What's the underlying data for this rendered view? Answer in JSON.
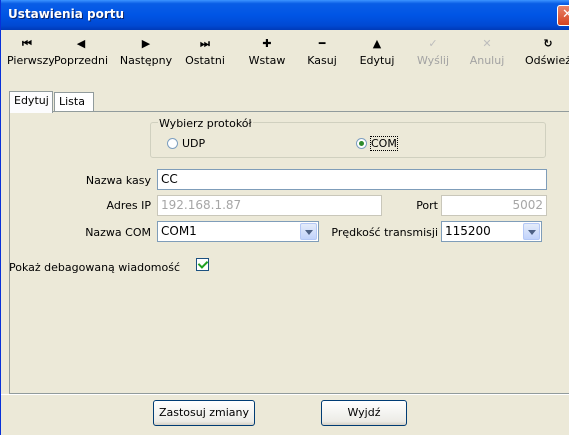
{
  "window": {
    "title": "Ustawienia portu",
    "close_glyph": "✕"
  },
  "toolbar": {
    "buttons": [
      {
        "label": "Pierwszy",
        "icon": "first-icon",
        "glyph": "⏮"
      },
      {
        "label": "Poprzedni",
        "icon": "previous-icon",
        "glyph": "◀"
      },
      {
        "label": "Następny",
        "icon": "next-icon",
        "glyph": "▶"
      },
      {
        "label": "Ostatni",
        "icon": "last-icon",
        "glyph": "⏭"
      },
      {
        "label": "Wstaw",
        "icon": "plus-icon",
        "glyph": "✚"
      },
      {
        "label": "Kasuj",
        "icon": "minus-icon",
        "glyph": "━"
      },
      {
        "label": "Edytuj",
        "icon": "up-arrow-icon",
        "glyph": "▲"
      },
      {
        "label": "Wyślij",
        "icon": "check-icon",
        "glyph": "✓",
        "disabled": true
      },
      {
        "label": "Anuluj",
        "icon": "cancel-icon",
        "glyph": "✕",
        "disabled": true
      },
      {
        "label": "Odśwież",
        "icon": "refresh-icon",
        "glyph": "↻"
      }
    ]
  },
  "tabs": [
    {
      "label": "Edytuj",
      "active": true
    },
    {
      "label": "Lista",
      "active": false
    }
  ],
  "form": {
    "protocol": {
      "title": "Wybierz protokół",
      "options": [
        {
          "label": "UDP",
          "selected": false
        },
        {
          "label": "COM",
          "selected": true
        }
      ]
    },
    "name_label": "Nazwa kasy",
    "name_value": "CC",
    "ip_label": "Adres IP",
    "ip_value": "192.168.1.87",
    "port_label": "Port",
    "port_value": "5002",
    "com_label": "Nazwa COM",
    "com_value": "COM1",
    "speed_label": "Prędkość transmisji",
    "speed_value": "115200",
    "debug_label": "Pokaż debagowaną wiadomość",
    "debug_checked": true
  },
  "buttons": {
    "apply_label": "Zastosuj zmiany",
    "exit_label": "Wyjdź"
  },
  "colors": {
    "title_bar": "#0055e5",
    "face": "#ece9d8",
    "close": "#d4421f"
  }
}
